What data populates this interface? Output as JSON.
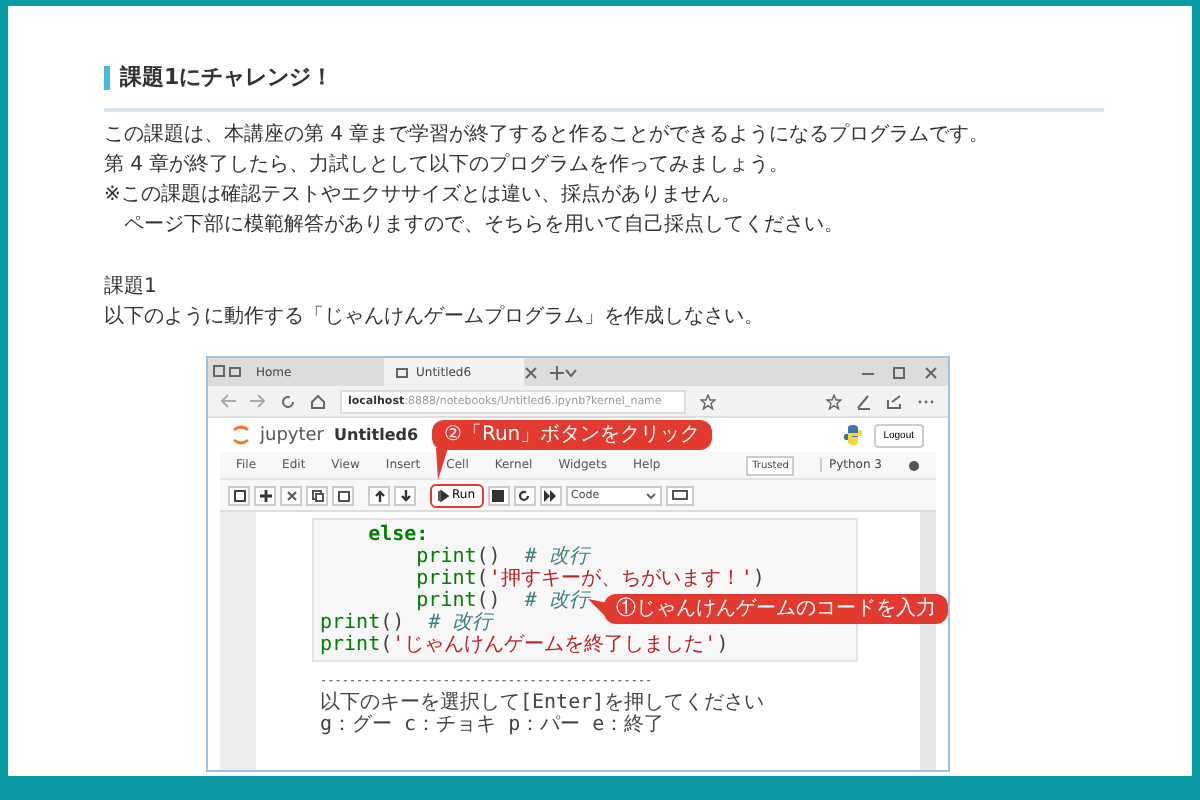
{
  "heading": "課題1にチャレンジ！",
  "intro_lines": [
    "この課題は、本講座の第 4 章まで学習が終了すると作ることができるようになるプログラムです。",
    "第 4 章が終了したら、力試しとして以下のプログラムを作ってみましょう。",
    "※この課題は確認テストやエクササイズとは違い、採点がありません。",
    "　ページ下部に模範解答がありますので、そちらを用いて自己採点してください。"
  ],
  "task": {
    "title": "課題1",
    "text": "以下のように動作する「じゃんけんゲームプログラム」を作成しなさい。"
  },
  "screenshot": {
    "browser_tabs": [
      {
        "label": "Home",
        "selected": false
      },
      {
        "label": "Untitled6",
        "selected": true
      }
    ],
    "address": "**localhost**:8888/notebooks/Untitled6.ipynb?kernel_name",
    "brand": "jupyter",
    "notebook_title": "Untitled6",
    "logout": "Logout",
    "menu": [
      "File",
      "Edit",
      "View",
      "Insert",
      "Cell",
      "Kernel",
      "Widgets",
      "Help"
    ],
    "trusted": "Trusted",
    "kernel": "Python 3",
    "run_label": "Run",
    "cell_type": "Code",
    "code_lines": [
      [
        {
          "kind": "keyword",
          "text": "    else:"
        }
      ],
      [
        {
          "kind": "builtin",
          "text": "        print"
        },
        {
          "kind": "plain",
          "text": "()  "
        },
        {
          "kind": "comment",
          "text": "# 改行"
        }
      ],
      [
        {
          "kind": "builtin",
          "text": "        print"
        },
        {
          "kind": "plain",
          "text": "("
        },
        {
          "kind": "string",
          "text": "'押すキーが、ちがいます！'"
        },
        {
          "kind": "plain",
          "text": ")"
        }
      ],
      [
        {
          "kind": "builtin",
          "text": "        print"
        },
        {
          "kind": "plain",
          "text": "()  "
        },
        {
          "kind": "comment",
          "text": "# 改行"
        }
      ],
      [
        {
          "kind": "builtin",
          "text": "print"
        },
        {
          "kind": "plain",
          "text": "()  "
        },
        {
          "kind": "comment",
          "text": "# 改行"
        }
      ],
      [
        {
          "kind": "builtin",
          "text": "print"
        },
        {
          "kind": "plain",
          "text": "("
        },
        {
          "kind": "string",
          "text": "'じゃんけんゲームを終了しました'"
        },
        {
          "kind": "plain",
          "text": ")"
        }
      ]
    ],
    "output_lines": [
      "----------------------------------------------",
      "以下のキーを選択して[Enter]を押してください",
      "g：グー c：チョキ p：パー e：終了"
    ],
    "callouts": [
      {
        "kind": "run",
        "text": "②「Run」ボタンをクリック"
      },
      {
        "kind": "code",
        "text": "①じゃんけんゲームのコードを入力"
      }
    ]
  }
}
